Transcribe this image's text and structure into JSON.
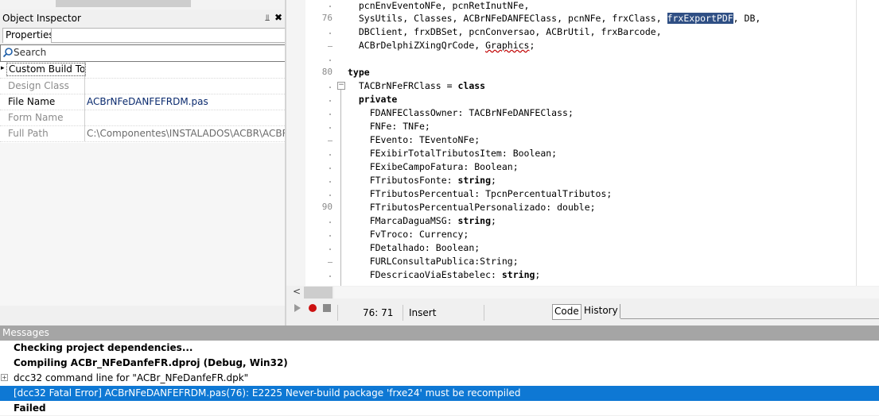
{
  "object_inspector": {
    "title": "Object Inspector",
    "pin_glyph": "📌",
    "close_glyph": "✖",
    "tab_label": "Properties",
    "search_placeholder": "Search",
    "rows": [
      {
        "key": "Custom Build Too",
        "value": "",
        "expandable": true
      },
      {
        "key": "Design Class",
        "value": ""
      },
      {
        "key": "File Name",
        "value": "ACBrNFeDANFEFRDM.pas"
      },
      {
        "key": "Form Name",
        "value": ""
      },
      {
        "key": "Full Path",
        "value": "C:\\Componentes\\INSTALADOS\\ACBR\\ACBR\\Fo"
      }
    ]
  },
  "editor": {
    "line_numbers": {
      "l76": "76",
      "l80": "80",
      "l90": "90"
    },
    "fold_glyph": "−",
    "lines": [
      {
        "text": "  pcnEnvEventoNFe, pcnRetInutNFe,"
      },
      {
        "pre": "  SysUtils, Classes, ACBrNFeDANFEClass, pcnNFe, frxClass, ",
        "sel": "frxExportPDF",
        "post": ", DB,"
      },
      {
        "text": "  DBClient, frxDBSet, pcnConversao, ACBrUtil, frxBarcode,"
      },
      {
        "pre": "  ACBrDelphiZXingQrCode, ",
        "squig": "Graphics",
        "post": ";"
      },
      {
        "text": ""
      },
      {
        "kw": "type",
        "text": ""
      },
      {
        "pre": "  TACBrNFeFRClass = ",
        "kw2": "class"
      },
      {
        "pre": "  ",
        "kw2": "private"
      },
      {
        "text": "    FDANFEClassOwner: TACBrNFeDANFEClass;"
      },
      {
        "text": "    FNFe: TNFe;"
      },
      {
        "text": "    FEvento: TEventoNFe;"
      },
      {
        "text": "    FExibirTotalTributosItem: Boolean;"
      },
      {
        "text": "    FExibeCampoFatura: Boolean;"
      },
      {
        "pre": "    FTributosFonte: ",
        "kw2": "string",
        "post": ";"
      },
      {
        "text": "    FTributosPercentual: TpcnPercentualTributos;"
      },
      {
        "text": "    FTributosPercentualPersonalizado: double;"
      },
      {
        "pre": "    FMarcaDaguaMSG: ",
        "kw2": "string",
        "post": ";"
      },
      {
        "text": "    FvTroco: Currency;"
      },
      {
        "text": "    FDetalhado: Boolean;"
      },
      {
        "text": "    FURLConsultaPublica:String;"
      },
      {
        "pre": "    FDescricaoViaEstabelec: ",
        "kw2": "string",
        "post": ";"
      }
    ]
  },
  "scrollbar": {
    "left_arrow": "<"
  },
  "status_bar": {
    "position": "76: 71",
    "mode": "Insert",
    "tabs": {
      "code": "Code",
      "history": "History"
    }
  },
  "messages": {
    "title": "Messages",
    "items": [
      {
        "text": "Checking project dependencies...",
        "bold": true
      },
      {
        "text": "Compiling ACBr_NFeDanfeFR.dproj (Debug, Win32)",
        "bold": true
      },
      {
        "text": "dcc32 command line for \"ACBr_NFeDanfeFR.dpk\"",
        "expandable": true
      },
      {
        "text": "[dcc32 Fatal Error] ACBrNFeDANFEFRDM.pas(76): E2225 Never-build package 'frxe24' must be recompiled",
        "highlighted": true
      },
      {
        "text": "Failed",
        "bold": true
      }
    ]
  },
  "colors": {
    "selection": "#0e78d4",
    "error_dot": "#cc1111",
    "messages_header": "#a5a5a5"
  }
}
